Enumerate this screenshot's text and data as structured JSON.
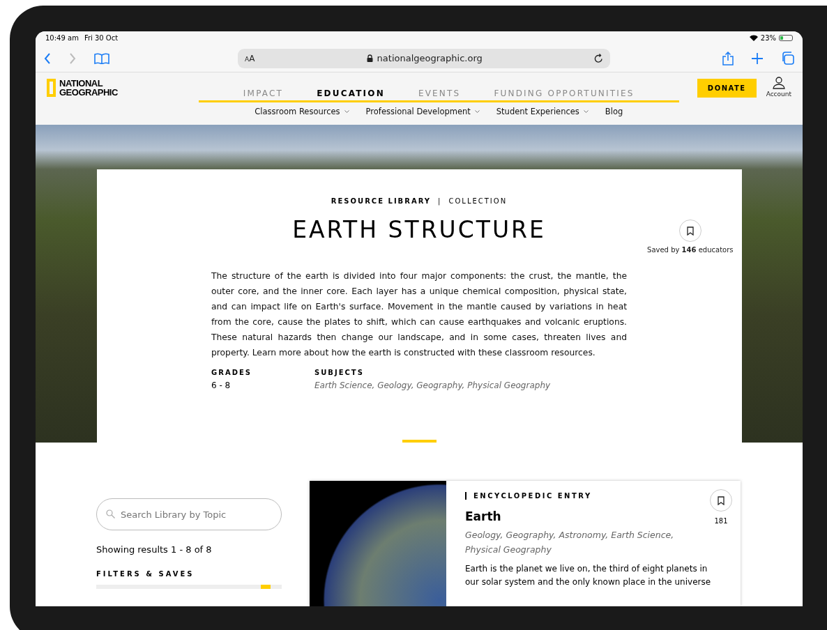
{
  "status_bar": {
    "time": "10:49 am",
    "date": "Fri 30 Oct",
    "battery": "23%"
  },
  "browser": {
    "text_size": "AA",
    "url": "nationalgeographic.org"
  },
  "site_header": {
    "logo": [
      "NATIONAL",
      "GEOGRAPHIC"
    ],
    "nav": [
      {
        "label": "IMPACT",
        "selected": false
      },
      {
        "label": "EDUCATION",
        "selected": true
      },
      {
        "label": "EVENTS",
        "selected": false
      },
      {
        "label": "FUNDING OPPORTUNITIES",
        "selected": false
      }
    ],
    "subnav": [
      {
        "label": "Classroom Resources",
        "dropdown": true
      },
      {
        "label": "Professional Development",
        "dropdown": true
      },
      {
        "label": "Student Experiences",
        "dropdown": true
      },
      {
        "label": "Blog",
        "dropdown": false
      }
    ],
    "donate": "DONATE",
    "account": "Account"
  },
  "collection": {
    "section": "RESOURCE LIBRARY",
    "separator": "|",
    "type": "COLLECTION",
    "title": "EARTH STRUCTURE",
    "saved": "Saved by **146** educators",
    "description": "The structure of the earth is divided into four major components: the crust, the mantle, the outer core, and the inner core. Each layer has a unique chemical composition, physical state, and can impact life on Earth's surface. Movement in the mantle caused by variations in heat from the core, cause the plates to shift, which can cause earthquakes and volcanic eruptions. These natural hazards then change our landscape, and in some cases, threaten lives and property. Learn more about how the earth is constructed with these classroom resources.",
    "grades_label": "GRADES",
    "grades": "6 - 8",
    "subjects_label": "SUBJECTS",
    "subjects": "Earth Science, Geology, Geography, Physical Geography"
  },
  "sidebar": {
    "search": {
      "placeholder": "Search Library by Topic"
    },
    "results": "Showing results 1 - 8 of 8",
    "filters": "FILTERS & SAVES"
  },
  "results": [
    {
      "type": "ENCYCLOPEDIC ENTRY",
      "title": "Earth",
      "saves": "181",
      "subjects": "Geology, Geography, Astronomy, Earth Science, Physical Geography",
      "description": "Earth is the planet we live on, the third of eight planets in our solar system and the only known place in the universe"
    }
  ]
}
